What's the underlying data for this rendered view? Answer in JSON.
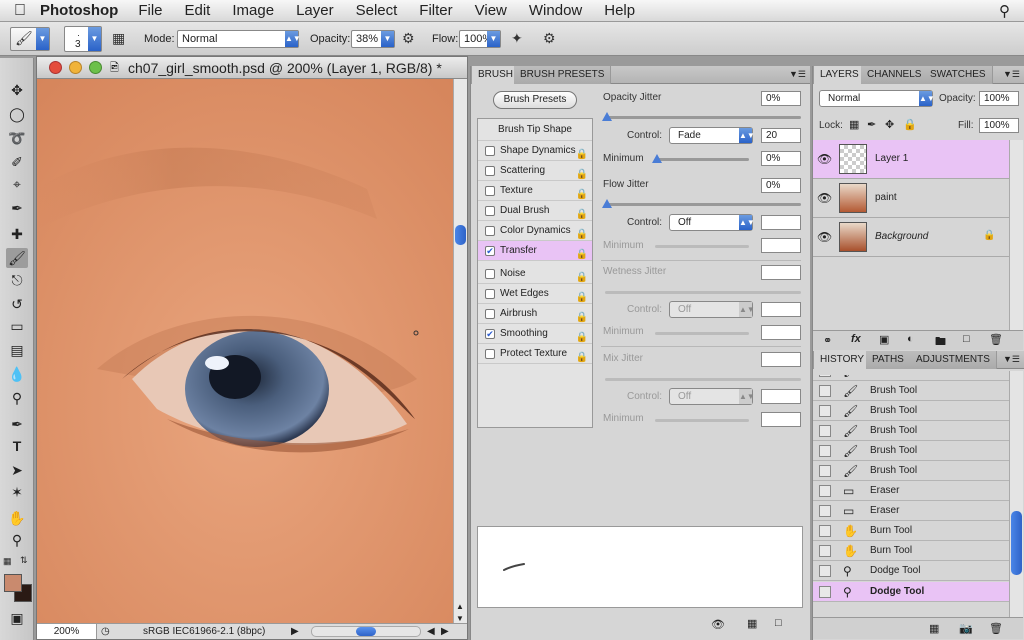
{
  "menubar": {
    "app_name": "Photoshop",
    "items": [
      "File",
      "Edit",
      "Image",
      "Layer",
      "Select",
      "Filter",
      "View",
      "Window",
      "Help"
    ]
  },
  "options": {
    "brush_size": "3",
    "mode_label": "Mode:",
    "mode_value": "Normal",
    "opacity_label": "Opacity:",
    "opacity_value": "38%",
    "flow_label": "Flow:",
    "flow_value": "100%"
  },
  "document": {
    "title": "ch07_girl_smooth.psd @ 200% (Layer 1, RGB/8) *",
    "zoom": "200%",
    "profile": "sRGB IEC61966-2.1 (8bpc)"
  },
  "brush_panel": {
    "tabs": [
      "BRUSH",
      "BRUSH PRESETS"
    ],
    "presets_button": "Brush Presets",
    "tip_shape": "Brush Tip Shape",
    "items": [
      {
        "label": "Shape Dynamics",
        "checked": false
      },
      {
        "label": "Scattering",
        "checked": false
      },
      {
        "label": "Texture",
        "checked": false
      },
      {
        "label": "Dual Brush",
        "checked": false
      },
      {
        "label": "Color Dynamics",
        "checked": false
      },
      {
        "label": "Transfer",
        "checked": true
      },
      {
        "label": "Noise",
        "checked": false
      },
      {
        "label": "Wet Edges",
        "checked": false
      },
      {
        "label": "Airbrush",
        "checked": false
      },
      {
        "label": "Smoothing",
        "checked": true
      },
      {
        "label": "Protect Texture",
        "checked": false
      }
    ],
    "opacity_jitter_label": "Opacity Jitter",
    "opacity_jitter_value": "0%",
    "control_label": "Control:",
    "control1_value": "Fade",
    "control1_steps": "20",
    "minimum_label": "Minimum",
    "minimum1_value": "0%",
    "flow_jitter_label": "Flow Jitter",
    "flow_jitter_value": "0%",
    "control2_value": "Off",
    "wetness_jitter_label": "Wetness Jitter",
    "control3_value": "Off",
    "mix_jitter_label": "Mix Jitter",
    "control4_value": "Off"
  },
  "layers_panel": {
    "tabs": [
      "LAYERS",
      "CHANNELS",
      "SWATCHES"
    ],
    "blend_mode": "Normal",
    "opacity_label": "Opacity:",
    "opacity_value": "100%",
    "lock_label": "Lock:",
    "fill_label": "Fill:",
    "fill_value": "100%",
    "layers": [
      {
        "name": "Layer 1",
        "selected": true
      },
      {
        "name": "paint",
        "selected": false
      },
      {
        "name": "Background",
        "selected": false
      }
    ]
  },
  "history_panel": {
    "tabs": [
      "HISTORY",
      "PATHS",
      "ADJUSTMENTS"
    ],
    "items": [
      {
        "name": "Brush Tool",
        "icon": "brush-icon"
      },
      {
        "name": "Brush Tool",
        "icon": "brush-icon"
      },
      {
        "name": "Brush Tool",
        "icon": "brush-icon"
      },
      {
        "name": "Brush Tool",
        "icon": "brush-icon"
      },
      {
        "name": "Brush Tool",
        "icon": "brush-icon"
      },
      {
        "name": "Brush Tool",
        "icon": "brush-icon"
      },
      {
        "name": "Eraser",
        "icon": "eraser-icon"
      },
      {
        "name": "Eraser",
        "icon": "eraser-icon"
      },
      {
        "name": "Burn Tool",
        "icon": "burn-icon"
      },
      {
        "name": "Burn Tool",
        "icon": "burn-icon"
      },
      {
        "name": "Dodge Tool",
        "icon": "dodge-icon"
      },
      {
        "name": "Dodge Tool",
        "icon": "dodge-icon",
        "selected": true
      }
    ]
  },
  "colors": {
    "selected_row": "#e9c3f5",
    "foreground": "#c98a6e",
    "background": "#2a1a14"
  }
}
